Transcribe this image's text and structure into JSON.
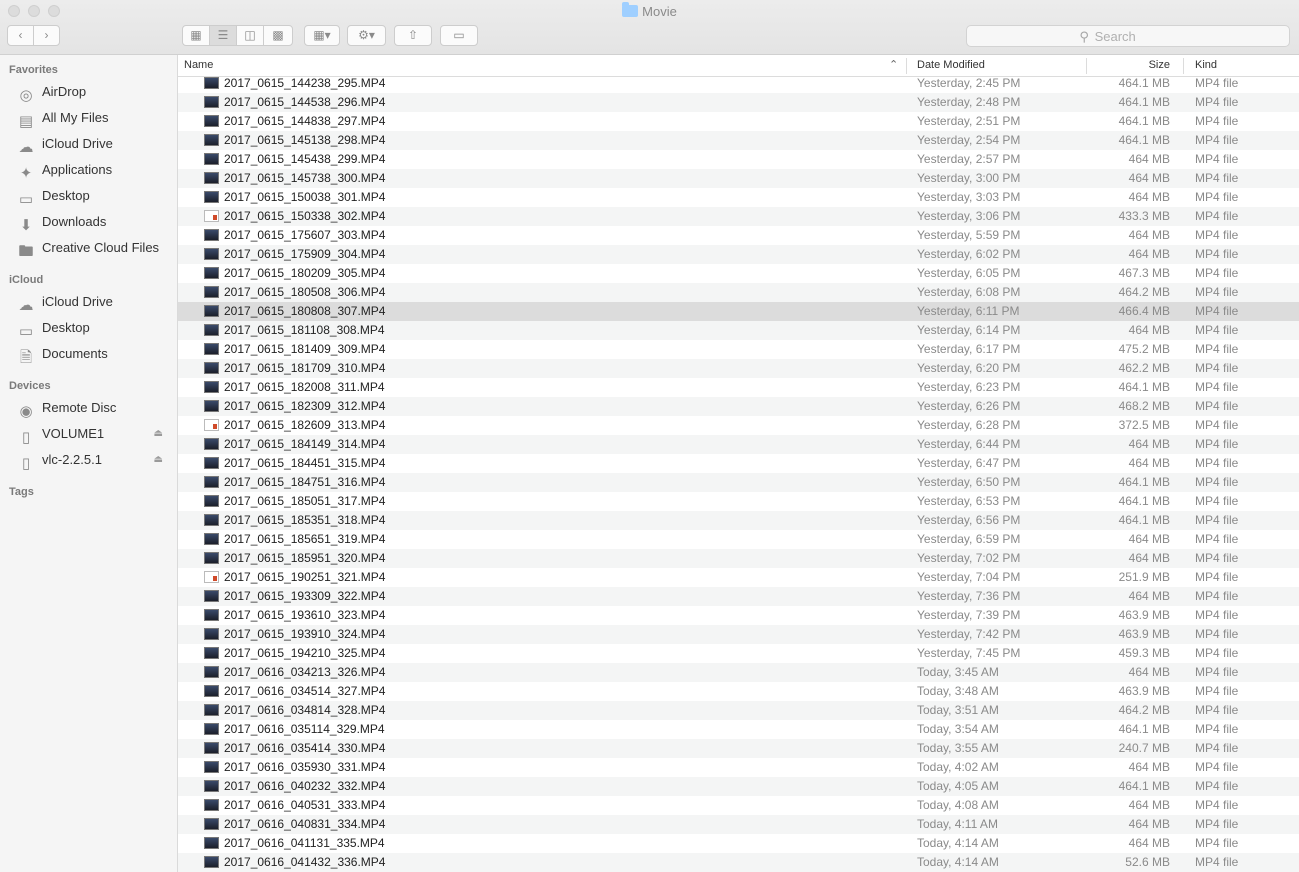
{
  "window": {
    "title": "Movie"
  },
  "toolbar": {
    "search_placeholder": "Search",
    "icons": [
      "back-icon",
      "forward-icon",
      "icon-view-icon",
      "list-view-icon",
      "column-view-icon",
      "cover-flow-icon",
      "arrange-icon",
      "gear-icon",
      "share-icon",
      "tag-icon"
    ]
  },
  "sidebar": {
    "favorites_label": "Favorites",
    "favorites": [
      {
        "label": "AirDrop",
        "icon": "airdrop-icon"
      },
      {
        "label": "All My Files",
        "icon": "all-files-icon"
      },
      {
        "label": "iCloud Drive",
        "icon": "cloud-icon"
      },
      {
        "label": "Applications",
        "icon": "applications-icon"
      },
      {
        "label": "Desktop",
        "icon": "desktop-icon"
      },
      {
        "label": "Downloads",
        "icon": "downloads-icon"
      },
      {
        "label": "Creative Cloud Files",
        "icon": "folder-icon"
      }
    ],
    "icloud_label": "iCloud",
    "icloud": [
      {
        "label": "iCloud Drive",
        "icon": "cloud-icon"
      },
      {
        "label": "Desktop",
        "icon": "desktop-icon"
      },
      {
        "label": "Documents",
        "icon": "document-icon"
      }
    ],
    "devices_label": "Devices",
    "devices": [
      {
        "label": "Remote Disc",
        "icon": "disc-icon"
      },
      {
        "label": "VOLUME1",
        "icon": "drive-icon"
      },
      {
        "label": "vlc-2.2.5.1",
        "icon": "drive-icon"
      }
    ],
    "tags_label": "Tags"
  },
  "columns": {
    "name": "Name",
    "date": "Date Modified",
    "size": "Size",
    "kind": "Kind"
  },
  "files": [
    {
      "name": "2017_0615_144238_295.MP4",
      "date": "Yesterday, 2:45 PM",
      "size": "464.1 MB",
      "kind": "MP4 file"
    },
    {
      "name": "2017_0615_144538_296.MP4",
      "date": "Yesterday, 2:48 PM",
      "size": "464.1 MB",
      "kind": "MP4 file"
    },
    {
      "name": "2017_0615_144838_297.MP4",
      "date": "Yesterday, 2:51 PM",
      "size": "464.1 MB",
      "kind": "MP4 file"
    },
    {
      "name": "2017_0615_145138_298.MP4",
      "date": "Yesterday, 2:54 PM",
      "size": "464.1 MB",
      "kind": "MP4 file"
    },
    {
      "name": "2017_0615_145438_299.MP4",
      "date": "Yesterday, 2:57 PM",
      "size": "464 MB",
      "kind": "MP4 file"
    },
    {
      "name": "2017_0615_145738_300.MP4",
      "date": "Yesterday, 3:00 PM",
      "size": "464 MB",
      "kind": "MP4 file"
    },
    {
      "name": "2017_0615_150038_301.MP4",
      "date": "Yesterday, 3:03 PM",
      "size": "464 MB",
      "kind": "MP4 file"
    },
    {
      "name": "2017_0615_150338_302.MP4",
      "date": "Yesterday, 3:06 PM",
      "size": "433.3 MB",
      "kind": "MP4 file",
      "doc": true
    },
    {
      "name": "2017_0615_175607_303.MP4",
      "date": "Yesterday, 5:59 PM",
      "size": "464 MB",
      "kind": "MP4 file"
    },
    {
      "name": "2017_0615_175909_304.MP4",
      "date": "Yesterday, 6:02 PM",
      "size": "464 MB",
      "kind": "MP4 file"
    },
    {
      "name": "2017_0615_180209_305.MP4",
      "date": "Yesterday, 6:05 PM",
      "size": "467.3 MB",
      "kind": "MP4 file"
    },
    {
      "name": "2017_0615_180508_306.MP4",
      "date": "Yesterday, 6:08 PM",
      "size": "464.2 MB",
      "kind": "MP4 file"
    },
    {
      "name": "2017_0615_180808_307.MP4",
      "date": "Yesterday, 6:11 PM",
      "size": "466.4 MB",
      "kind": "MP4 file",
      "highlight": true
    },
    {
      "name": "2017_0615_181108_308.MP4",
      "date": "Yesterday, 6:14 PM",
      "size": "464 MB",
      "kind": "MP4 file"
    },
    {
      "name": "2017_0615_181409_309.MP4",
      "date": "Yesterday, 6:17 PM",
      "size": "475.2 MB",
      "kind": "MP4 file"
    },
    {
      "name": "2017_0615_181709_310.MP4",
      "date": "Yesterday, 6:20 PM",
      "size": "462.2 MB",
      "kind": "MP4 file"
    },
    {
      "name": "2017_0615_182008_311.MP4",
      "date": "Yesterday, 6:23 PM",
      "size": "464.1 MB",
      "kind": "MP4 file"
    },
    {
      "name": "2017_0615_182309_312.MP4",
      "date": "Yesterday, 6:26 PM",
      "size": "468.2 MB",
      "kind": "MP4 file"
    },
    {
      "name": "2017_0615_182609_313.MP4",
      "date": "Yesterday, 6:28 PM",
      "size": "372.5 MB",
      "kind": "MP4 file",
      "doc": true
    },
    {
      "name": "2017_0615_184149_314.MP4",
      "date": "Yesterday, 6:44 PM",
      "size": "464 MB",
      "kind": "MP4 file"
    },
    {
      "name": "2017_0615_184451_315.MP4",
      "date": "Yesterday, 6:47 PM",
      "size": "464 MB",
      "kind": "MP4 file"
    },
    {
      "name": "2017_0615_184751_316.MP4",
      "date": "Yesterday, 6:50 PM",
      "size": "464.1 MB",
      "kind": "MP4 file"
    },
    {
      "name": "2017_0615_185051_317.MP4",
      "date": "Yesterday, 6:53 PM",
      "size": "464.1 MB",
      "kind": "MP4 file"
    },
    {
      "name": "2017_0615_185351_318.MP4",
      "date": "Yesterday, 6:56 PM",
      "size": "464.1 MB",
      "kind": "MP4 file"
    },
    {
      "name": "2017_0615_185651_319.MP4",
      "date": "Yesterday, 6:59 PM",
      "size": "464 MB",
      "kind": "MP4 file"
    },
    {
      "name": "2017_0615_185951_320.MP4",
      "date": "Yesterday, 7:02 PM",
      "size": "464 MB",
      "kind": "MP4 file"
    },
    {
      "name": "2017_0615_190251_321.MP4",
      "date": "Yesterday, 7:04 PM",
      "size": "251.9 MB",
      "kind": "MP4 file",
      "doc": true
    },
    {
      "name": "2017_0615_193309_322.MP4",
      "date": "Yesterday, 7:36 PM",
      "size": "464 MB",
      "kind": "MP4 file"
    },
    {
      "name": "2017_0615_193610_323.MP4",
      "date": "Yesterday, 7:39 PM",
      "size": "463.9 MB",
      "kind": "MP4 file"
    },
    {
      "name": "2017_0615_193910_324.MP4",
      "date": "Yesterday, 7:42 PM",
      "size": "463.9 MB",
      "kind": "MP4 file"
    },
    {
      "name": "2017_0615_194210_325.MP4",
      "date": "Yesterday, 7:45 PM",
      "size": "459.3 MB",
      "kind": "MP4 file"
    },
    {
      "name": "2017_0616_034213_326.MP4",
      "date": "Today, 3:45 AM",
      "size": "464 MB",
      "kind": "MP4 file"
    },
    {
      "name": "2017_0616_034514_327.MP4",
      "date": "Today, 3:48 AM",
      "size": "463.9 MB",
      "kind": "MP4 file"
    },
    {
      "name": "2017_0616_034814_328.MP4",
      "date": "Today, 3:51 AM",
      "size": "464.2 MB",
      "kind": "MP4 file"
    },
    {
      "name": "2017_0616_035114_329.MP4",
      "date": "Today, 3:54 AM",
      "size": "464.1 MB",
      "kind": "MP4 file"
    },
    {
      "name": "2017_0616_035414_330.MP4",
      "date": "Today, 3:55 AM",
      "size": "240.7 MB",
      "kind": "MP4 file"
    },
    {
      "name": "2017_0616_035930_331.MP4",
      "date": "Today, 4:02 AM",
      "size": "464 MB",
      "kind": "MP4 file"
    },
    {
      "name": "2017_0616_040232_332.MP4",
      "date": "Today, 4:05 AM",
      "size": "464.1 MB",
      "kind": "MP4 file"
    },
    {
      "name": "2017_0616_040531_333.MP4",
      "date": "Today, 4:08 AM",
      "size": "464 MB",
      "kind": "MP4 file"
    },
    {
      "name": "2017_0616_040831_334.MP4",
      "date": "Today, 4:11 AM",
      "size": "464 MB",
      "kind": "MP4 file"
    },
    {
      "name": "2017_0616_041131_335.MP4",
      "date": "Today, 4:14 AM",
      "size": "464 MB",
      "kind": "MP4 file"
    },
    {
      "name": "2017_0616_041432_336.MP4",
      "date": "Today, 4:14 AM",
      "size": "52.6 MB",
      "kind": "MP4 file"
    }
  ]
}
